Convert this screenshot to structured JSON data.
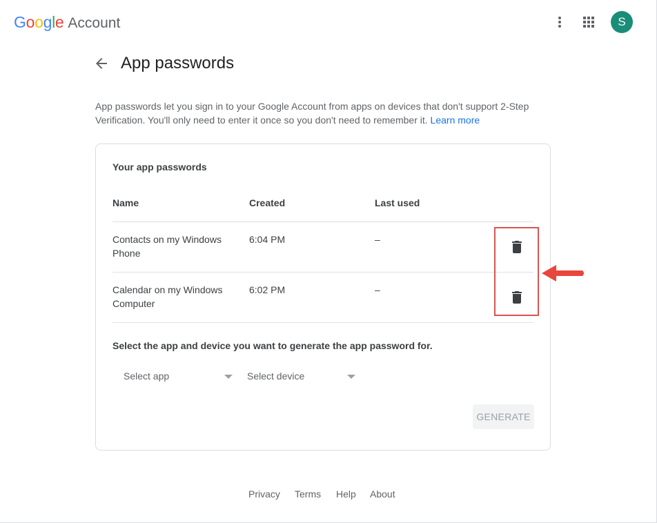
{
  "header": {
    "logo_letters": [
      {
        "char": "G",
        "color": "#4285F4"
      },
      {
        "char": "o",
        "color": "#EA4335"
      },
      {
        "char": "o",
        "color": "#FBBC05"
      },
      {
        "char": "g",
        "color": "#4285F4"
      },
      {
        "char": "l",
        "color": "#34A853"
      },
      {
        "char": "e",
        "color": "#EA4335"
      }
    ],
    "product": "Account",
    "avatar_initial": "S",
    "avatar_color": "#1a8d78",
    "icons": [
      "more-vert-icon",
      "apps-grid-icon"
    ]
  },
  "page": {
    "title": "App passwords",
    "description": "App passwords let you sign in to your Google Account from apps on devices that don't support 2-Step Verification. You'll only need to enter it once so you don't need to remember it.",
    "learn_more": "Learn more"
  },
  "card": {
    "title": "Your app passwords",
    "columns": {
      "name": "Name",
      "created": "Created",
      "last_used": "Last used"
    },
    "rows": [
      {
        "name": "Contacts on my Windows Phone",
        "created": "6:04 PM",
        "last_used": "–"
      },
      {
        "name": "Calendar on my Windows Computer",
        "created": "6:02 PM",
        "last_used": "–"
      }
    ],
    "select_prompt": "Select the app and device you want to generate the app password for.",
    "select_app": "Select app",
    "select_device": "Select device",
    "generate": "GENERATE"
  },
  "annotation": {
    "color": "#d9534f"
  },
  "footer": {
    "privacy": "Privacy",
    "terms": "Terms",
    "help": "Help",
    "about": "About"
  }
}
